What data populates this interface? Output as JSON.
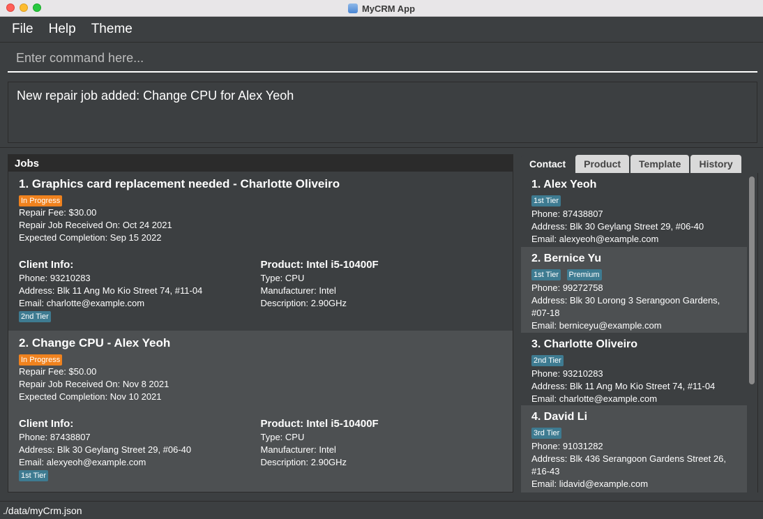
{
  "window": {
    "title": "MyCRM App"
  },
  "menu": {
    "file": "File",
    "help": "Help",
    "theme": "Theme"
  },
  "command": {
    "placeholder": "Enter command here..."
  },
  "result": {
    "text": "New repair job added: Change CPU for Alex Yeoh"
  },
  "jobs": {
    "header": "Jobs",
    "items": [
      {
        "title": "1. Graphics card replacement needed - Charlotte Oliveiro",
        "status": "In Progress",
        "fee": "Repair Fee: $30.00",
        "received": "Repair Job Received On: Oct 24 2021",
        "expected": "Expected Completion: Sep 15 2022",
        "client_title": "Client Info:",
        "client_phone": "Phone: 93210283",
        "client_address": "Address: Blk 11 Ang Mo Kio Street 74, #11-04",
        "client_email": "Email: charlotte@example.com",
        "client_tier": "2nd Tier",
        "product_title": "Product: Intel i5-10400F",
        "product_type": "Type: CPU",
        "product_manufacturer": "Manufacturer: Intel",
        "product_description": "Description: 2.90GHz"
      },
      {
        "title": "2. Change CPU - Alex Yeoh",
        "status": "In Progress",
        "fee": "Repair Fee: $50.00",
        "received": "Repair Job Received On: Nov 8 2021",
        "expected": "Expected Completion: Nov 10 2021",
        "client_title": "Client Info:",
        "client_phone": "Phone: 87438807",
        "client_address": "Address: Blk 30 Geylang Street 29, #06-40",
        "client_email": "Email: alexyeoh@example.com",
        "client_tier": "1st Tier",
        "product_title": "Product: Intel i5-10400F",
        "product_type": "Type: CPU",
        "product_manufacturer": "Manufacturer: Intel",
        "product_description": "Description: 2.90GHz"
      }
    ]
  },
  "tabs": [
    "Contact",
    "Product",
    "Template",
    "History"
  ],
  "contacts": [
    {
      "name": "1.  Alex Yeoh",
      "tags": [
        "1st Tier"
      ],
      "phone": "Phone: 87438807",
      "address": "Address: Blk 30 Geylang Street 29, #06-40",
      "email": "Email: alexyeoh@example.com"
    },
    {
      "name": "2.  Bernice Yu",
      "tags": [
        "1st Tier",
        "Premium"
      ],
      "phone": "Phone: 99272758",
      "address": "Address: Blk 30 Lorong 3 Serangoon Gardens, #07-18",
      "email": "Email: berniceyu@example.com"
    },
    {
      "name": "3.  Charlotte Oliveiro",
      "tags": [
        "2nd Tier"
      ],
      "phone": "Phone: 93210283",
      "address": "Address: Blk 11 Ang Mo Kio Street 74, #11-04",
      "email": "Email: charlotte@example.com"
    },
    {
      "name": "4.  David Li",
      "tags": [
        "3rd Tier"
      ],
      "phone": "Phone: 91031282",
      "address": "Address: Blk 436 Serangoon Gardens Street 26, #16-43",
      "email": "Email: lidavid@example.com"
    }
  ],
  "status": {
    "path": "./data/myCrm.json"
  }
}
